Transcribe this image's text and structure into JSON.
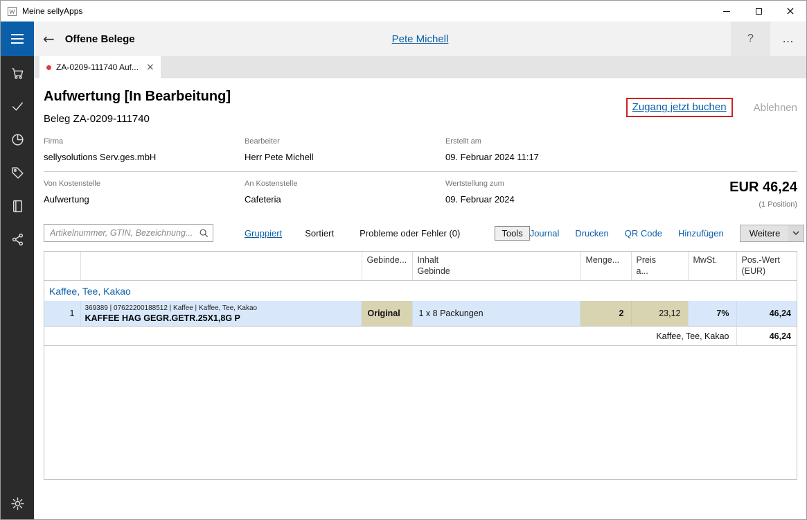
{
  "colors": {
    "accent": "#0b5fa8",
    "sidebar-bg": "#2b2b2b",
    "header-bg": "#f2f2f2",
    "tabstrip-bg": "#e4e4e4",
    "row-highlight": "#d8e8fa",
    "cell-khaki": "#d8d3b0",
    "annotation-red": "#cf2222",
    "tab-dot": "#e03e3e",
    "muted": "#767676"
  },
  "window": {
    "title": "Meine sellyApps"
  },
  "header": {
    "title": "Offene Belege",
    "user": "Pete Michell",
    "help_label": "?",
    "more_label": "…"
  },
  "tab": {
    "label": "ZA-0209-111740 Auf...",
    "close": "×"
  },
  "document": {
    "title": "Aufwertung [In Bearbeitung]",
    "subtitle": "Beleg ZA-0209-111740",
    "action_book": "Zugang jetzt buchen",
    "action_reject": "Ablehnen",
    "fields": [
      {
        "label": "Firma",
        "value": "sellysolutions Serv.ges.mbH"
      },
      {
        "label": "Bearbeiter",
        "value": "Herr Pete Michell"
      },
      {
        "label": "Erstellt am",
        "value": "09. Februar 2024 11:17"
      },
      {
        "label": "Von Kostenstelle",
        "value": "Aufwertung"
      },
      {
        "label": "An Kostenstelle",
        "value": "Cafeteria"
      },
      {
        "label": "Wertstellung zum",
        "value": "09. Februar 2024"
      }
    ],
    "total_amount": "EUR 46,24",
    "total_positions": "(1 Position)"
  },
  "toolbar": {
    "search_placeholder": "Artikelnummer, GTIN, Bezeichnung...",
    "grouped": "Gruppiert",
    "sorted": "Sortiert",
    "problems": "Probleme oder Fehler (0)",
    "tools": "Tools",
    "journal": "Journal",
    "print": "Drucken",
    "qr": "QR Code",
    "add": "Hinzufügen",
    "more": "Weitere"
  },
  "table": {
    "headers": {
      "num": "",
      "description": "",
      "gebinde": "Gebinde...",
      "inhalt": "Inhalt\nGebinde",
      "menge": "Menge...",
      "preis": "Preis\na...",
      "mwst": "MwSt.",
      "wert": "Pos.-Wert\n(EUR)"
    },
    "group_label": "Kaffee, Tee, Kakao",
    "rows": [
      {
        "num": "1",
        "meta": "369389 | 07622200188512 | Kaffee | Kaffee, Tee, Kakao",
        "name": "KAFFEE HAG GEGR.GETR.25X1,8G P",
        "gebinde": "Original",
        "inhalt": "1 x 8 Packungen",
        "menge": "2",
        "preis": "23,12",
        "mwst": "7%",
        "wert": "46,24"
      }
    ],
    "summary_label": "Kaffee, Tee, Kakao",
    "summary_value": "46,24"
  }
}
